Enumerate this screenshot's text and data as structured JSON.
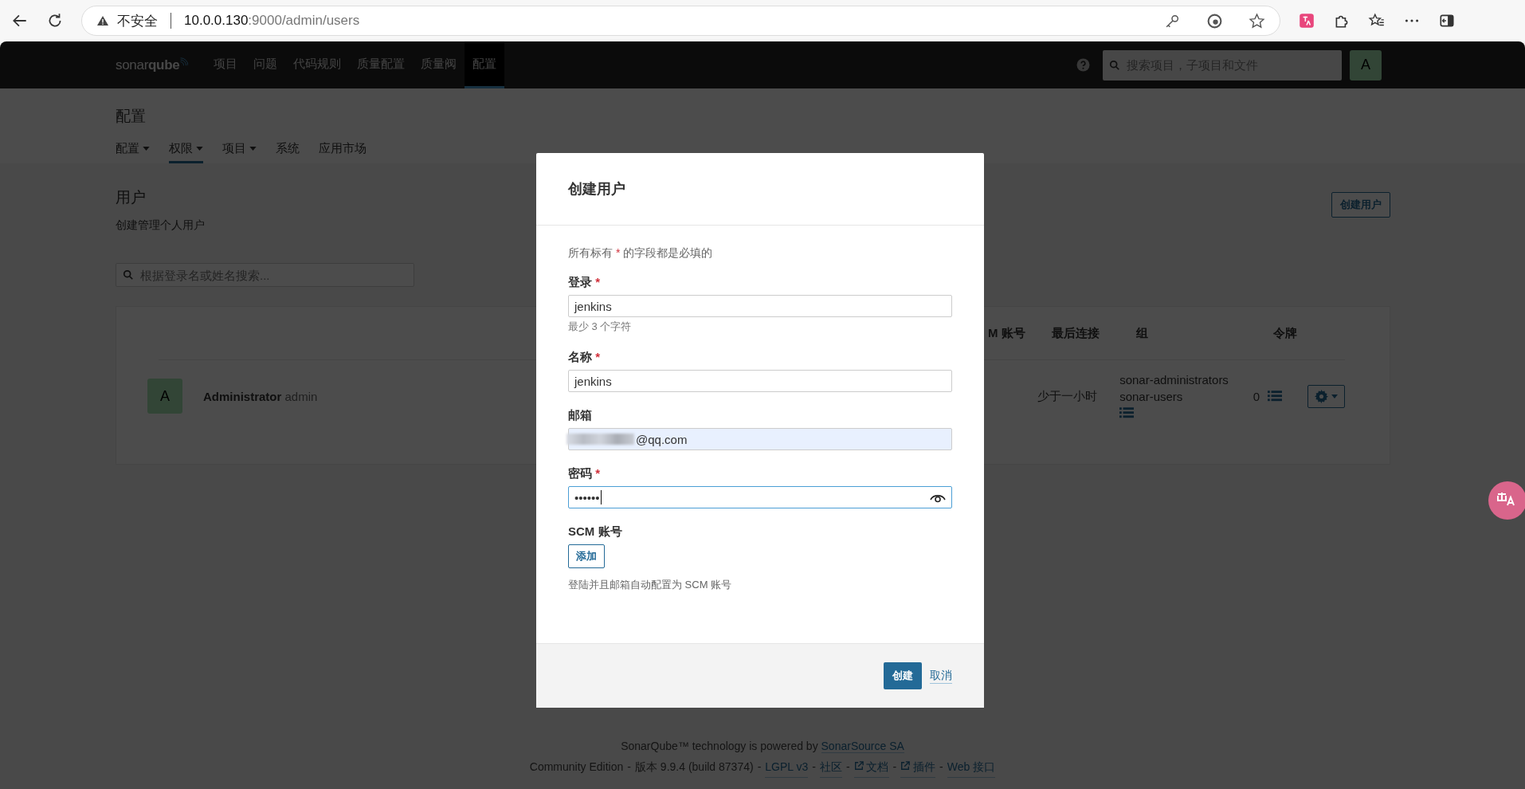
{
  "browser": {
    "security_label": "不安全",
    "url_host": "10.0.0.130",
    "url_path": ":9000/admin/users"
  },
  "navbar": {
    "logo": "sonar**qube**",
    "items": [
      {
        "label": "项目",
        "selected": false
      },
      {
        "label": "问题",
        "selected": false
      },
      {
        "label": "代码规则",
        "selected": false
      },
      {
        "label": "质量配置",
        "selected": false
      },
      {
        "label": "质量阀",
        "selected": false
      },
      {
        "label": "配置",
        "selected": true
      }
    ],
    "search": {
      "placeholder": "搜索项目，子项目和文件"
    },
    "avatar": "A"
  },
  "page_header": {
    "title": "配置",
    "tabs": [
      {
        "label": "配置",
        "dropdown": true,
        "selected": false
      },
      {
        "label": "权限",
        "dropdown": true,
        "selected": true
      },
      {
        "label": "项目",
        "dropdown": true,
        "selected": false
      },
      {
        "label": "系统",
        "dropdown": false,
        "selected": false
      },
      {
        "label": "应用市场",
        "dropdown": false,
        "selected": false
      }
    ]
  },
  "users": {
    "title": "用户",
    "description": "创建管理个人用户",
    "create_button": "创建用户",
    "search": {
      "placeholder": "根据登录名或姓名搜索..."
    },
    "table": {
      "columns": [
        "M 账号",
        "最后连接",
        "组",
        "令牌"
      ],
      "rows": [
        {
          "avatar": "A",
          "name": "Administrator",
          "login": "admin",
          "last_connection": "少于一小时",
          "groups": [
            "sonar-administrators",
            "sonar-users"
          ],
          "tokens": "0"
        }
      ]
    }
  },
  "dialog": {
    "title": "创建用户",
    "note": {
      "before": "所有标有",
      "mark": "*",
      "after": "的字段都是必填的"
    },
    "fields": [
      {
        "kind": "text",
        "label": "登录",
        "required_mark": "*",
        "value": "jenkins",
        "hint": "最少 3 个字符",
        "focused": false,
        "autofilled": false,
        "redacted": false
      },
      {
        "kind": "text",
        "label": "名称",
        "required_mark": "*",
        "value": "jenkins",
        "focused": false,
        "autofilled": false,
        "redacted": false
      },
      {
        "kind": "email",
        "label": "邮箱",
        "value": "@qq.com",
        "focused": false,
        "autofilled": true,
        "redacted": true
      },
      {
        "kind": "password",
        "label": "密码",
        "required_mark": "*",
        "value": "••••••",
        "focused": true,
        "autofilled": false,
        "redacted": false
      }
    ],
    "scm": {
      "label": "SCM 账号",
      "add_button": "添加",
      "help": "登陆并且邮箱自动配置为 SCM 账号"
    },
    "submit_button": "创建",
    "cancel_link": "取消"
  },
  "footer": {
    "line1": {
      "text": "SonarQube™ technology is powered by",
      "link": "SonarSource SA"
    },
    "line2": [
      {
        "kind": "text",
        "text": "Community Edition"
      },
      {
        "kind": "sep",
        "text": "-"
      },
      {
        "kind": "text",
        "text": "版本 9.9.4 (build 87374)"
      },
      {
        "kind": "sep",
        "text": "-"
      },
      {
        "kind": "link",
        "text": "LGPL v3"
      },
      {
        "kind": "sep",
        "text": "-"
      },
      {
        "kind": "link",
        "text": "社区"
      },
      {
        "kind": "sep",
        "text": "-"
      },
      {
        "kind": "external",
        "text": "文档"
      },
      {
        "kind": "sep",
        "text": "-"
      },
      {
        "kind": "external",
        "text": "插件"
      },
      {
        "kind": "sep",
        "text": "-"
      },
      {
        "kind": "link",
        "text": "Web 接口"
      }
    ]
  }
}
